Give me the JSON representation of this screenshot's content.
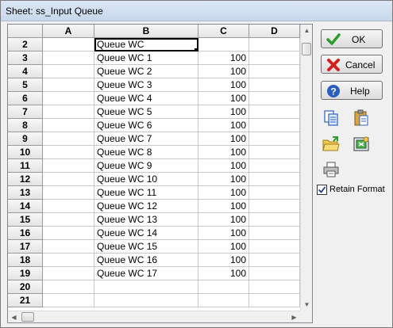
{
  "window": {
    "title": "Sheet: ss_Input Queue"
  },
  "grid": {
    "columns": [
      "A",
      "B",
      "C",
      "D"
    ],
    "rows": [
      {
        "num": "2",
        "a": "",
        "b": "Queue WC",
        "c": "",
        "d": ""
      },
      {
        "num": "3",
        "a": "",
        "b": "Queue WC 1",
        "c": "100",
        "d": ""
      },
      {
        "num": "4",
        "a": "",
        "b": "Queue WC 2",
        "c": "100",
        "d": ""
      },
      {
        "num": "5",
        "a": "",
        "b": "Queue WC 3",
        "c": "100",
        "d": ""
      },
      {
        "num": "6",
        "a": "",
        "b": "Queue WC 4",
        "c": "100",
        "d": ""
      },
      {
        "num": "7",
        "a": "",
        "b": "Queue WC 5",
        "c": "100",
        "d": ""
      },
      {
        "num": "8",
        "a": "",
        "b": "Queue WC 6",
        "c": "100",
        "d": ""
      },
      {
        "num": "9",
        "a": "",
        "b": "Queue WC 7",
        "c": "100",
        "d": ""
      },
      {
        "num": "10",
        "a": "",
        "b": "Queue WC 8",
        "c": "100",
        "d": ""
      },
      {
        "num": "11",
        "a": "",
        "b": "Queue WC 9",
        "c": "100",
        "d": ""
      },
      {
        "num": "12",
        "a": "",
        "b": "Queue WC 10",
        "c": "100",
        "d": ""
      },
      {
        "num": "13",
        "a": "",
        "b": "Queue WC 11",
        "c": "100",
        "d": ""
      },
      {
        "num": "14",
        "a": "",
        "b": "Queue WC 12",
        "c": "100",
        "d": ""
      },
      {
        "num": "15",
        "a": "",
        "b": "Queue WC 13",
        "c": "100",
        "d": ""
      },
      {
        "num": "16",
        "a": "",
        "b": "Queue WC 14",
        "c": "100",
        "d": ""
      },
      {
        "num": "17",
        "a": "",
        "b": "Queue WC 15",
        "c": "100",
        "d": ""
      },
      {
        "num": "18",
        "a": "",
        "b": "Queue WC 16",
        "c": "100",
        "d": ""
      },
      {
        "num": "19",
        "a": "",
        "b": "Queue WC 17",
        "c": "100",
        "d": ""
      },
      {
        "num": "20",
        "a": "",
        "b": "",
        "c": "",
        "d": ""
      },
      {
        "num": "21",
        "a": "",
        "b": "",
        "c": "",
        "d": ""
      }
    ]
  },
  "buttons": {
    "ok": {
      "label": "OK",
      "icon": "check-icon"
    },
    "cancel": {
      "label": "Cancel",
      "icon": "x-icon"
    },
    "help": {
      "label": "Help",
      "icon": "question-icon"
    }
  },
  "toolbar": [
    "copy-icon",
    "paste-icon",
    "open-folder-icon",
    "import-icon",
    "print-icon"
  ],
  "retain_format": {
    "label": "Retain Format",
    "checked": true
  },
  "colors": {
    "ok_green": "#2a9d2a",
    "cancel_red": "#d42020",
    "help_blue": "#2b5fbf"
  }
}
